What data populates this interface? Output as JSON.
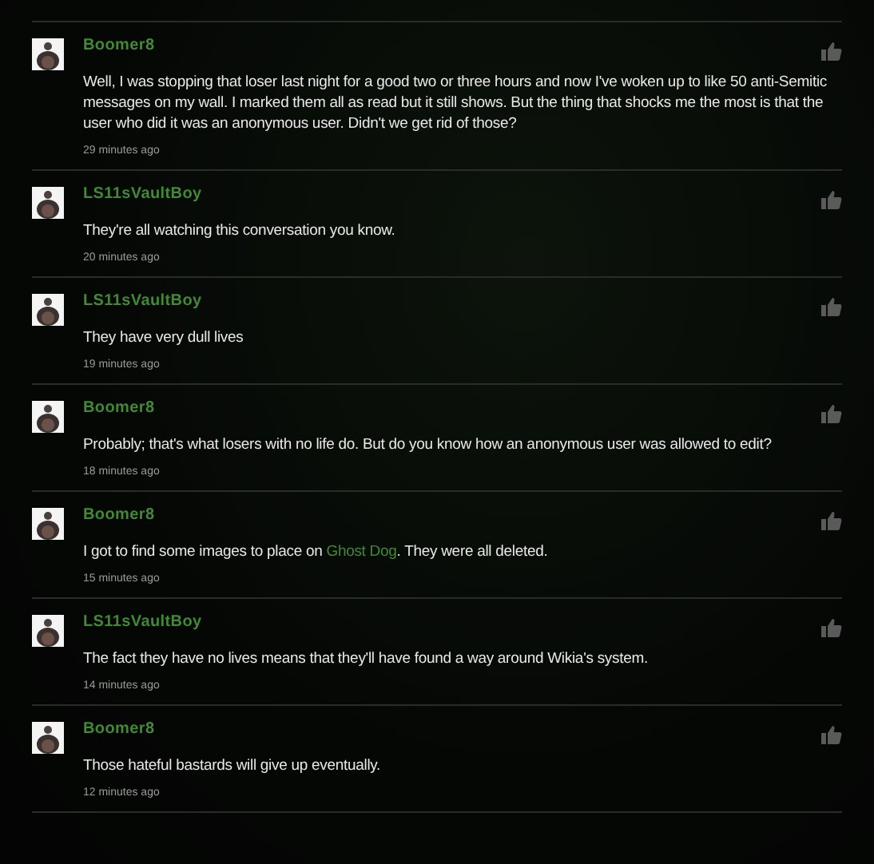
{
  "comments": [
    {
      "username": "Boomer8",
      "body": [
        {
          "kind": "text",
          "text": "Well, I was stopping that loser last night for a good two or three hours and now I've woken up to like 50 anti-Semitic messages on my wall. I marked them all as read but it still shows. But the thing that shocks me the most is that the user who did it was an anonymous user. Didn't we get rid of those?"
        }
      ],
      "time": "29 minutes ago"
    },
    {
      "username": "LS11sVaultBoy",
      "body": [
        {
          "kind": "text",
          "text": "They're all watching this conversation you know."
        }
      ],
      "time": "20 minutes ago"
    },
    {
      "username": "LS11sVaultBoy",
      "body": [
        {
          "kind": "text",
          "text": "They have very dull lives"
        }
      ],
      "time": "19 minutes ago"
    },
    {
      "username": "Boomer8",
      "body": [
        {
          "kind": "text",
          "text": "Probably; that's what losers with no life do. But do you know how an anonymous user was allowed to edit?"
        }
      ],
      "time": "18 minutes ago"
    },
    {
      "username": "Boomer8",
      "body": [
        {
          "kind": "text",
          "text": "I got to find some images to place on "
        },
        {
          "kind": "link",
          "text": "Ghost Dog"
        },
        {
          "kind": "text",
          "text": ". They were all deleted."
        }
      ],
      "time": "15 minutes ago"
    },
    {
      "username": "LS11sVaultBoy",
      "body": [
        {
          "kind": "text",
          "text": "The fact they have no lives means that they'll have found a way around Wikia's system."
        }
      ],
      "time": "14 minutes ago"
    },
    {
      "username": "Boomer8",
      "body": [
        {
          "kind": "text",
          "text": "Those hateful bastards will give up eventually."
        }
      ],
      "time": "12 minutes ago"
    }
  ]
}
